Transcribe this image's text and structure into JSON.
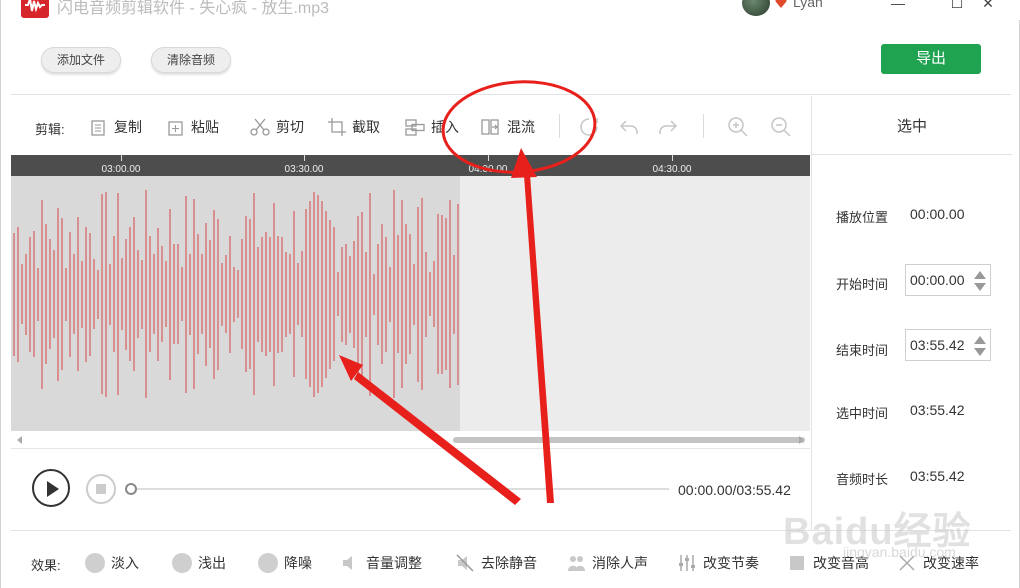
{
  "window": {
    "title": "闪电音频剪辑软件 - 失心疯 - 放生.mp3",
    "username": "Lyan",
    "min_glyph": "—",
    "max_glyph": "☐",
    "close_glyph": "✕"
  },
  "top": {
    "add_file_label": "添加文件",
    "clear_audio_label": "清除音频",
    "export_label": "导出"
  },
  "toolbar": {
    "edit_label": "剪辑:",
    "copy_label": "复制",
    "paste_label": "粘贴",
    "cut_label": "剪切",
    "crop_label": "截取",
    "insert_label": "插入",
    "mix_label": "混流"
  },
  "timeline": {
    "ticks": [
      "03:00.00",
      "03:30.00",
      "04:00.00",
      "04:30.00"
    ],
    "selection_fraction": 0.562,
    "scroll_thumb_start_fraction": 0.553
  },
  "right_panel": {
    "title": "选中",
    "play_position_label": "播放位置",
    "play_position_value": "00:00.00",
    "start_time_label": "开始时间",
    "start_time_value": "00:00.00",
    "end_time_label": "结束时间",
    "end_time_value": "03:55.42",
    "selected_time_label": "选中时间",
    "selected_time_value": "03:55.42",
    "duration_label": "音频时长",
    "duration_value": "03:55.42"
  },
  "playback": {
    "time_display": "00:00.00/03:55.42",
    "progress_fraction": 0
  },
  "effects": {
    "label": "效果:",
    "items": [
      "淡入",
      "浅出",
      "降噪",
      "音量调整",
      "去除静音",
      "消除人声",
      "改变节奏",
      "改变音高",
      "改变速率"
    ]
  },
  "watermark": {
    "brand": "Baidu经验",
    "sub": "jingyan.baidu.com"
  },
  "colors": {
    "accent_green": "#1fa351",
    "annotation_red": "#e8201c",
    "waveform": "#d98f8f",
    "app_logo": "#d6262a"
  }
}
